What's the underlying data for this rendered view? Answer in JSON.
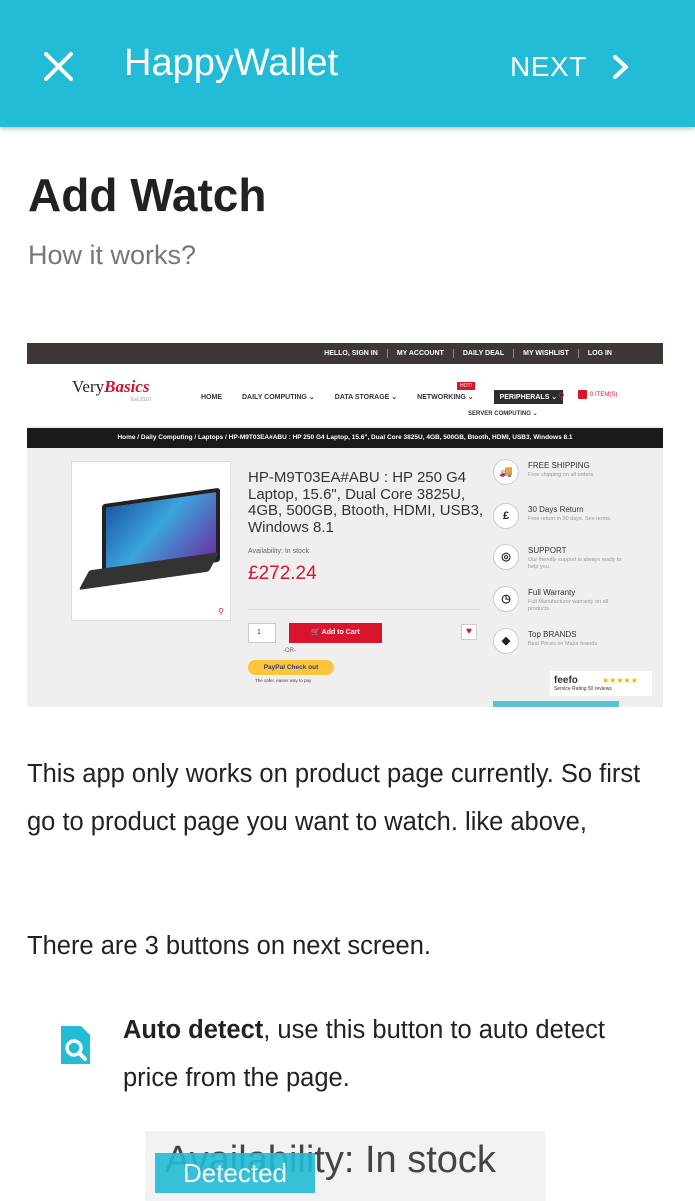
{
  "appbar": {
    "title": "HappyWallet",
    "next_label": "NEXT",
    "close_icon": "close-icon",
    "next_icon": "chevron-right-icon",
    "color": "#22bcd6"
  },
  "page": {
    "title": "Add Watch",
    "how_link": "How it works?"
  },
  "example_screenshot": {
    "topbar_links": [
      "HELLO, SIGN IN",
      "MY ACCOUNT",
      "DAILY DEAL",
      "MY WISHLIST",
      "LOG IN"
    ],
    "logo": "Very",
    "logo_bold": "Basics",
    "logo_sub": "Est 2010",
    "nav": [
      "HOME",
      "DAILY COMPUTING ⌄",
      "DATA STORAGE ⌄",
      "NETWORKING ⌄",
      "PERIPHERALS ⌄"
    ],
    "nav_badge": "HOT!",
    "subnav": "SERVER COMPUTING ⌄",
    "cart": "0 ITEM(S)",
    "breadcrumb": "Home / Daily Computing / Laptops / HP-M9T03EA#ABU : HP 250 G4 Laptop, 15.6\", Dual Core 3825U, 4GB, 500GB, Btooth, HDMI, USB3, Windows 8.1",
    "product_title": "HP-M9T03EA#ABU : HP 250 G4 Laptop, 15.6\", Dual Core 3825U, 4GB, 500GB, Btooth, HDMI, USB3, Windows 8.1",
    "availability": "Availability:  In stock",
    "price": "£272.24",
    "qty": "1",
    "add_to_cart": "🛒  Add to Cart",
    "or": "-OR-",
    "paypal": "PayPal  Check out",
    "paypal_sub": "The safer, easier way to pay",
    "features": [
      {
        "icon": "🚚",
        "title": "FREE SHIPPING",
        "sub": "Free shipping on all orders"
      },
      {
        "icon": "£",
        "title": "30 Days Return",
        "sub": "Free return in 30 days. See terms."
      },
      {
        "icon": "◎",
        "title": "SUPPORT",
        "sub": "Our friendly support is always ready to help you."
      },
      {
        "icon": "◷",
        "title": "Full Warranty",
        "sub": "Full Manufacturer warranty on all products."
      },
      {
        "icon": "◆",
        "title": "Top BRANDS",
        "sub": "Best Prices on Major brands"
      }
    ],
    "feefo": "feefo",
    "feefo_stars": "★★★★★",
    "feefo_sub": "Service Rating  50 reviews"
  },
  "content": {
    "para1": "This app only works on product page currently. So first go to product page you want to watch. like above,",
    "para2": "There are 3 buttons on next screen.",
    "auto_detect_bold": "Auto detect",
    "auto_detect_rest": ", use this button to auto detect price from the page.",
    "auto_detect_icon": "search-document-icon",
    "detect_example_text": "Availability:  In stock",
    "detect_badge": "Detected"
  }
}
